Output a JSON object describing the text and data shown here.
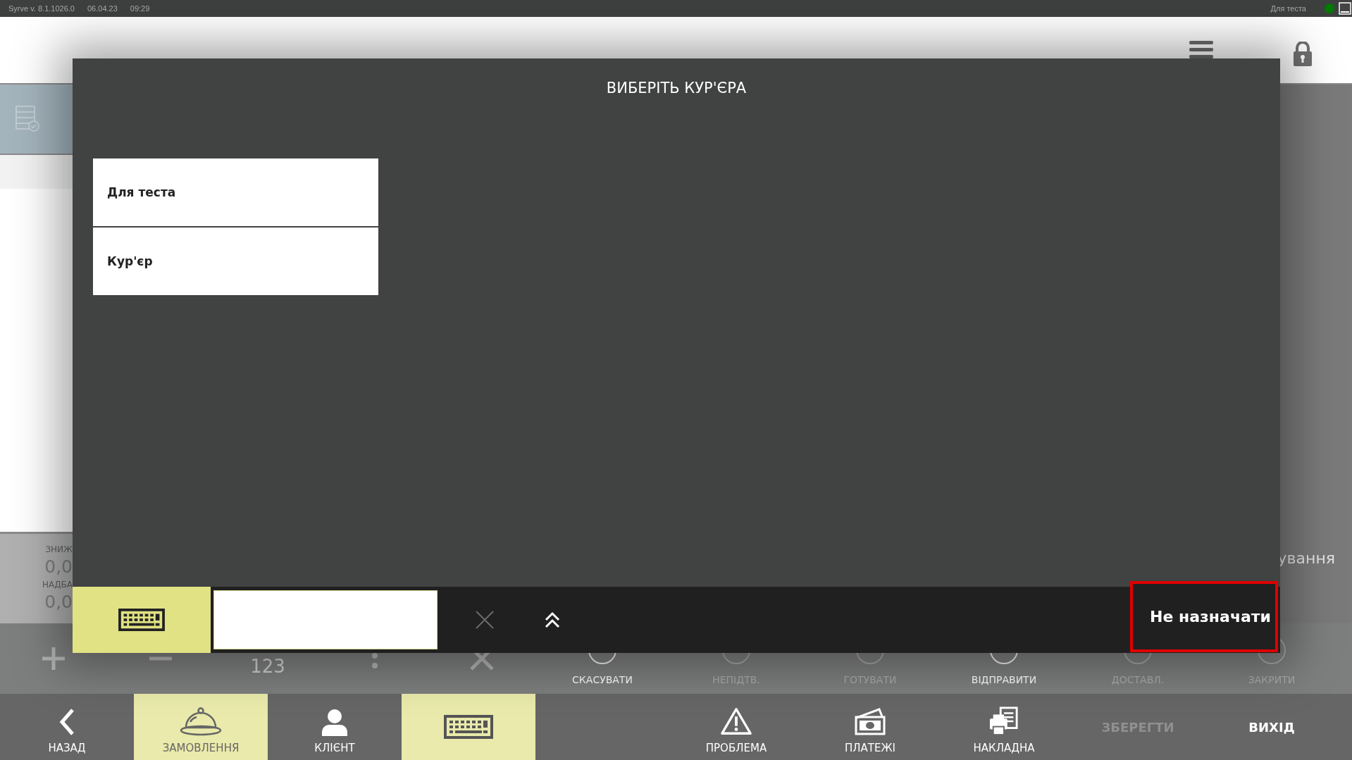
{
  "status_bar": {
    "app_version": "Syrve  v. 8.1.1026.0",
    "date": "06.04.23",
    "time": "09:29",
    "user": "Для теста",
    "online": true
  },
  "summary": [
    {
      "label": "ЗНИЖ",
      "value": "0,0"
    },
    {
      "label": "НАДБА",
      "value": "0,0"
    }
  ],
  "side_label": "ування",
  "actions": [
    {
      "kind": "plus"
    },
    {
      "kind": "minus"
    },
    {
      "kind": "text",
      "label": "123"
    },
    {
      "kind": "more"
    },
    {
      "kind": "delete"
    }
  ],
  "statuses": [
    {
      "label": "СКАСУВАТИ",
      "enabled": true
    },
    {
      "label": "НЕПІДТВ.",
      "enabled": false
    },
    {
      "label": "ГОТУВАТИ",
      "enabled": false
    },
    {
      "label": "ВІДПРАВИТИ",
      "enabled": true
    },
    {
      "label": "ДОСТАВЛ.",
      "enabled": false
    },
    {
      "label": "ЗАКРИТИ",
      "enabled": false
    }
  ],
  "nav_left": [
    {
      "kind": "back",
      "label": "НАЗАД",
      "selected": false
    },
    {
      "kind": "order",
      "label": "ЗАМОВЛЕННЯ",
      "selected": true
    },
    {
      "kind": "client",
      "label": "КЛІЄНТ",
      "selected": false
    },
    {
      "kind": "keyboard",
      "selected": true
    }
  ],
  "nav_right": [
    {
      "kind": "problem",
      "label": "ПРОБЛЕМА",
      "disabled": false
    },
    {
      "kind": "payments",
      "label": "ПЛАТЕЖІ",
      "disabled": false
    },
    {
      "kind": "invoice",
      "label": "НАКЛАДНА",
      "disabled": false
    },
    {
      "kind": "text",
      "label": "ЗБЕРЕГТИ",
      "disabled": true
    },
    {
      "kind": "text",
      "label": "ВИХІД",
      "disabled": false
    }
  ],
  "dialog": {
    "title": "ВИБЕРІТЬ КУР'ЄРА",
    "couriers": [
      {
        "name": "Для теста"
      },
      {
        "name": "Кур'єр"
      }
    ],
    "keyboard_on": true,
    "none_button": {
      "label": "Не назначати",
      "highlighted": true
    }
  }
}
